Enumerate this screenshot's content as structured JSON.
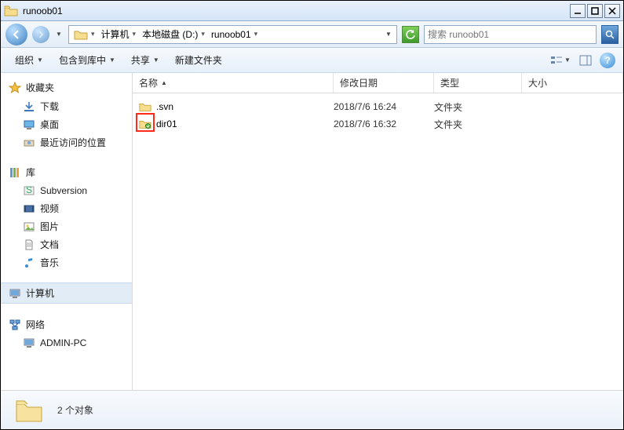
{
  "title": "runoob01",
  "breadcrumbs": {
    "b0": "计算机",
    "b1": "本地磁盘 (D:)",
    "b2": "runoob01"
  },
  "search": {
    "placeholder": "搜索 runoob01"
  },
  "toolbar": {
    "organize": "组织",
    "include": "包含到库中",
    "share": "共享",
    "newfolder": "新建文件夹"
  },
  "columns": {
    "name": "名称",
    "date": "修改日期",
    "type": "类型",
    "size": "大小"
  },
  "sidebar": {
    "favorites": "收藏夹",
    "downloads": "下载",
    "desktop": "桌面",
    "recent": "最近访问的位置",
    "libraries": "库",
    "subversion": "Subversion",
    "videos": "视频",
    "pictures": "图片",
    "documents": "文档",
    "music": "音乐",
    "computer": "计算机",
    "network": "网络",
    "adminpc": "ADMIN-PC"
  },
  "files": {
    "f0": {
      "name": ".svn",
      "date": "2018/7/6 16:24",
      "type": "文件夹"
    },
    "f1": {
      "name": "dir01",
      "date": "2018/7/6 16:32",
      "type": "文件夹"
    }
  },
  "status": {
    "text": "2 个对象"
  }
}
